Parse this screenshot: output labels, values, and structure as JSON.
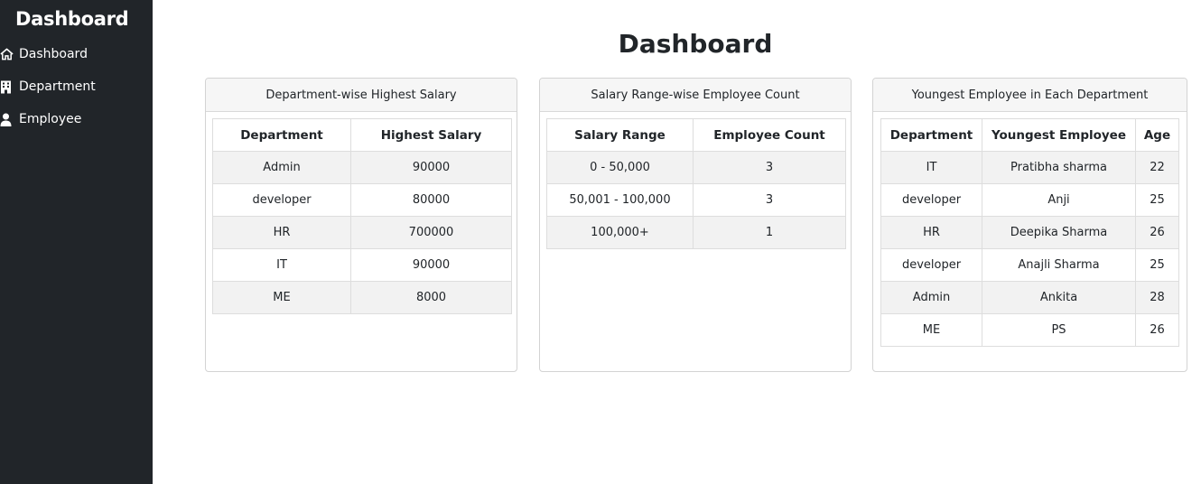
{
  "sidebar": {
    "title": "Dashboard",
    "items": [
      {
        "label": "Dashboard",
        "icon": "home-icon"
      },
      {
        "label": "Department",
        "icon": "building-icon"
      },
      {
        "label": "Employee",
        "icon": "user-icon"
      }
    ]
  },
  "main": {
    "title": "Dashboard"
  },
  "cards": {
    "highest_salary": {
      "title": "Department-wise Highest Salary",
      "columns": [
        "Department",
        "Highest Salary"
      ],
      "rows": [
        [
          "Admin",
          "90000"
        ],
        [
          "developer",
          "80000"
        ],
        [
          "HR",
          "700000"
        ],
        [
          "IT",
          "90000"
        ],
        [
          "ME",
          "8000"
        ]
      ]
    },
    "salary_range": {
      "title": "Salary Range-wise Employee Count",
      "columns": [
        "Salary Range",
        "Employee Count"
      ],
      "rows": [
        [
          "0 - 50,000",
          "3"
        ],
        [
          "50,001 - 100,000",
          "3"
        ],
        [
          "100,000+",
          "1"
        ]
      ]
    },
    "youngest": {
      "title": "Youngest Employee in Each Department",
      "columns": [
        "Department",
        "Youngest Employee",
        "Age"
      ],
      "rows": [
        [
          "IT",
          "Pratibha sharma",
          "22"
        ],
        [
          "developer",
          "Anji",
          "25"
        ],
        [
          "HR",
          "Deepika Sharma",
          "26"
        ],
        [
          "developer",
          "Anajli Sharma",
          "25"
        ],
        [
          "Admin",
          "Ankita",
          "28"
        ],
        [
          "ME",
          "PS",
          "26"
        ]
      ]
    }
  },
  "colors": {
    "sidebar_bg": "#212529",
    "sidebar_text": "#ffffff",
    "card_header_bg": "#f6f6f6",
    "row_stripe": "#f2f2f2"
  }
}
